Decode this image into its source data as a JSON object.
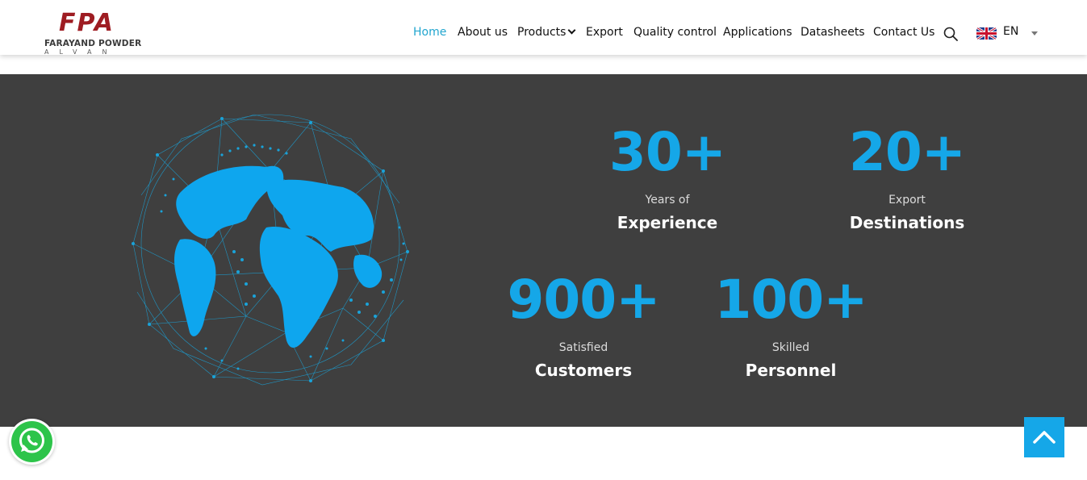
{
  "brand": {
    "mark": "FPA",
    "line1": "FARAYAND POWDER",
    "line2": "ALVAN",
    "colors": {
      "mark": "#9e1c22",
      "accent": "#22a6cf",
      "stat": "#15a7e8",
      "band": "#3f3f3f"
    }
  },
  "nav": {
    "items": [
      {
        "label": "Home",
        "active": true
      },
      {
        "label": "About us"
      },
      {
        "label": "Products",
        "has_dropdown": true
      },
      {
        "label": "Export"
      },
      {
        "label": "Quality control"
      },
      {
        "label": "Applications"
      },
      {
        "label": "Datasheets"
      },
      {
        "label": "Contact Us"
      }
    ],
    "search_icon": "search-icon",
    "language": {
      "label": "EN",
      "flag_icon": "uk-flag-icon"
    }
  },
  "stats": [
    {
      "number": "30+",
      "sub": "Years of",
      "main": "Experience"
    },
    {
      "number": "20+",
      "sub": "Export",
      "main": "Destinations"
    },
    {
      "number": "900+",
      "sub": "Satisfied",
      "main": "Customers"
    },
    {
      "number": "100+",
      "sub": "Skilled",
      "main": "Personnel"
    }
  ],
  "floating": {
    "whatsapp_icon": "whatsapp-icon",
    "back_to_top_icon": "chevron-up-icon"
  }
}
